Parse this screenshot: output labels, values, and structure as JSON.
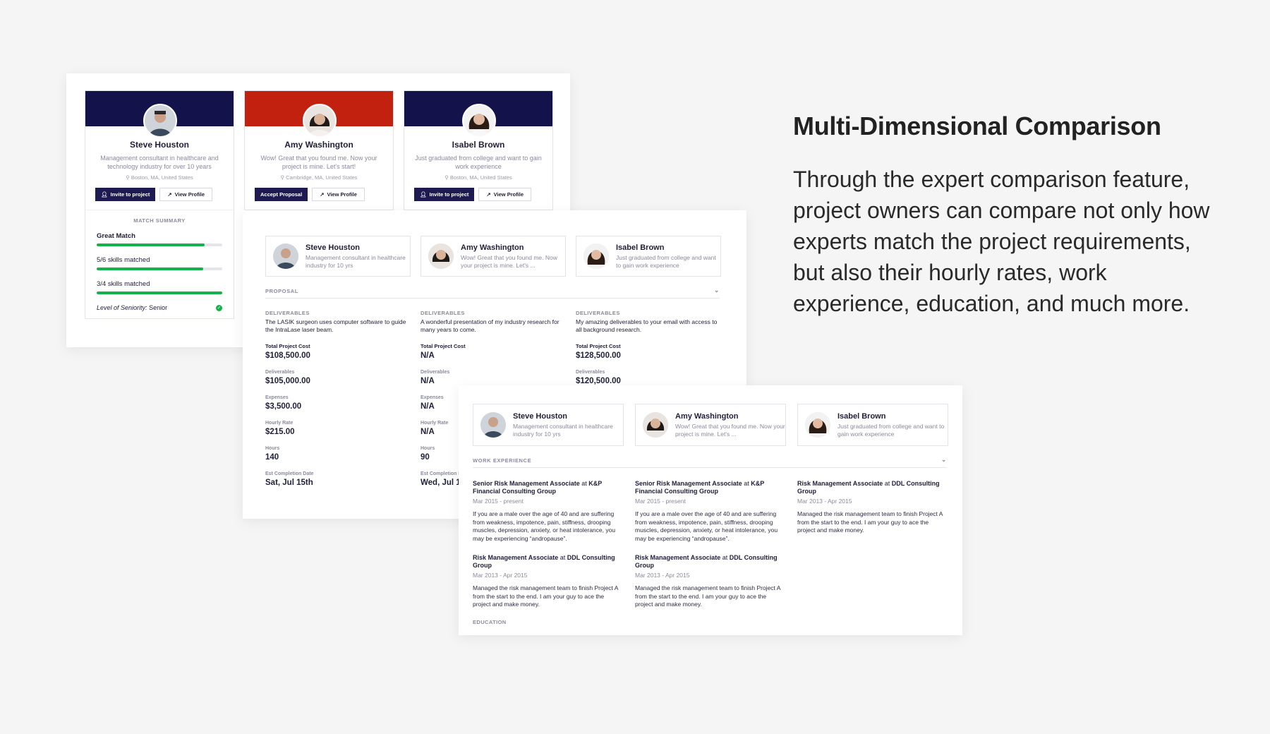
{
  "experts": [
    {
      "name": "Steve Houston",
      "desc": "Management consultant in healthcare and technology industry for over 10 years",
      "short": "Management consultant in healthcare industry for 10 yrs",
      "location": "Boston, MA, United States",
      "primary": "Invite to project",
      "secondary": "View Profile",
      "banner": "#14124a"
    },
    {
      "name": "Amy Washington",
      "desc": "Wow! Great that you found me. Now your project is mine. Let's start!",
      "short": "Wow! Great that you found me. Now your project is mine. Let's ...",
      "location": "Cambridge, MA, United States",
      "primary": "Accept Proposal",
      "secondary": "View Profile",
      "banner": "#c3210f"
    },
    {
      "name": "Isabel Brown",
      "desc": "Just graduated from college and want to gain work experience",
      "short": "Just graduated from college and want to gain work experience",
      "location": "Boston, MA, United States",
      "primary": "Invite to project",
      "secondary": "View Profile",
      "banner": "#14124a"
    }
  ],
  "match_summary": {
    "title": "MATCH SUMMARY",
    "rows": [
      {
        "label": "Great Match",
        "pct": 0.86
      },
      {
        "label": "5/6 skills matched",
        "pct": 0.85
      },
      {
        "label": "3/4 skills matched",
        "pct": 1.0
      }
    ],
    "seniority_label": "Level of Seniority:",
    "seniority_value": "Senior"
  },
  "proposal": {
    "section": "PROPOSAL",
    "deliverables_label": "DELIVERABLES",
    "cost_label": "Total Project Cost",
    "fields": [
      "Deliverables",
      "Expenses",
      "Hourly Rate",
      "Hours",
      "Est Completion Date"
    ],
    "cols": [
      {
        "deliv": "The LASIK surgeon uses computer software to guide the IntraLase laser beam.",
        "cost": "$108,500.00",
        "values": [
          "$105,000.00",
          "$3,500.00",
          "$215.00",
          "140",
          "Sat, Jul 15th"
        ]
      },
      {
        "deliv": "A wonderful presentation of my industry research for many years to come.",
        "cost": "N/A",
        "values": [
          "N/A",
          "N/A",
          "N/A",
          "90",
          "Wed, Jul 1"
        ]
      },
      {
        "deliv": "My amazing deliverables to your email with access to all background research.",
        "cost": "$128,500.00",
        "values": [
          "$120,500.00"
        ]
      }
    ]
  },
  "work": {
    "section": "WORK EXPERIENCE",
    "next_section": "EDUCATION",
    "at": "at",
    "cols": [
      [
        {
          "title": "Senior Risk Management Associate",
          "company": "K&P Financial Consulting Group",
          "dates": "Mar 2015 - present",
          "desc": "If you are a male over the age of 40 and are suffering from weakness, impotence, pain, stiffness, drooping muscles, depression, anxiety, or heat intolerance, you may be experiencing “andropause”."
        },
        {
          "title": "Risk Management Associate",
          "company": "DDL Consulting Group",
          "dates": "Mar 2013 - Apr 2015",
          "desc": "Managed the risk management team to finish Project A from the start to the end. I am your guy to ace the project and make money."
        }
      ],
      [
        {
          "title": "Senior Risk Management Associate",
          "company": "K&P Financial Consulting Group",
          "dates": "Mar 2015 - present",
          "desc": "If you are a male over the age of 40 and are suffering from weakness, impotence, pain, stiffness, drooping muscles, depression, anxiety, or heat intolerance, you may be experiencing “andropause”."
        },
        {
          "title": "Risk Management Associate",
          "company": "DDL Consulting Group",
          "dates": "Mar 2013 - Apr 2015",
          "desc": "Managed the risk management team to finish Project A from the start to the end. I am your guy to ace the project and make money."
        }
      ],
      [
        {
          "title": "Risk Management Associate",
          "company": "DDL Consulting Group",
          "dates": "Mar 2013 - Apr 2015",
          "desc": "Managed the risk management team to finish Project A from the start to the end. I am your guy to ace the project and make money."
        }
      ]
    ]
  },
  "copy": {
    "heading": "Multi-Dimensional Comparison",
    "paragraph": "Through the expert comparison feature, project owners can compare not only how experts match the project requirements, but also their hourly rates, work experience, education, and much more."
  },
  "colors": {
    "accent": "#1d1b4f",
    "match_green": "#13b24b",
    "red_banner": "#c3210f"
  }
}
